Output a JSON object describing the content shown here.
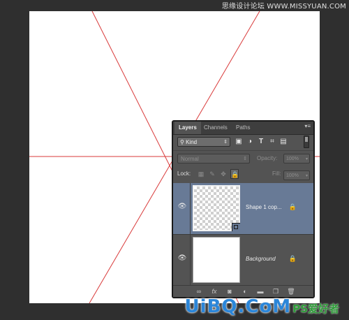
{
  "watermark": {
    "top": "思缘设计论坛 WWW.MISSYUAN.COM",
    "bottom_main": "UiBQ.CoM",
    "bottom_sub": "PS爱好者"
  },
  "colors": {
    "guide": "#d93a3a",
    "panel_bg": "#535353",
    "selected_layer": "#687a96",
    "app_bg": "#2f2f2f"
  },
  "layers_panel": {
    "tabs": [
      {
        "label": "Layers",
        "active": true
      },
      {
        "label": "Channels",
        "active": false
      },
      {
        "label": "Paths",
        "active": false
      }
    ],
    "menu_icon": "panel-menu-icon",
    "filter": {
      "kind_label": "Kind",
      "icons": [
        "pixel-filter-icon",
        "adjustment-filter-icon",
        "type-filter-icon",
        "shape-filter-icon",
        "smart-object-filter-icon"
      ]
    },
    "blend_mode": "Normal",
    "opacity_label": "Opacity:",
    "opacity_value": "100%",
    "lock_label": "Lock:",
    "lock_icons": [
      "lock-transparent-icon",
      "lock-image-icon",
      "lock-position-icon",
      "lock-all-icon"
    ],
    "fill_label": "Fill:",
    "fill_value": "100%",
    "layers": [
      {
        "name": "Shape 1 cop...",
        "selected": true,
        "visible": true,
        "locked": true,
        "thumbnail": "transparent"
      },
      {
        "name": "Background",
        "selected": false,
        "visible": true,
        "locked": true,
        "thumbnail": "white"
      }
    ],
    "footer_icons": [
      "link-icon",
      "fx-icon",
      "mask-icon",
      "adjustment-icon",
      "folder-icon",
      "new-layer-icon",
      "trash-icon"
    ]
  }
}
